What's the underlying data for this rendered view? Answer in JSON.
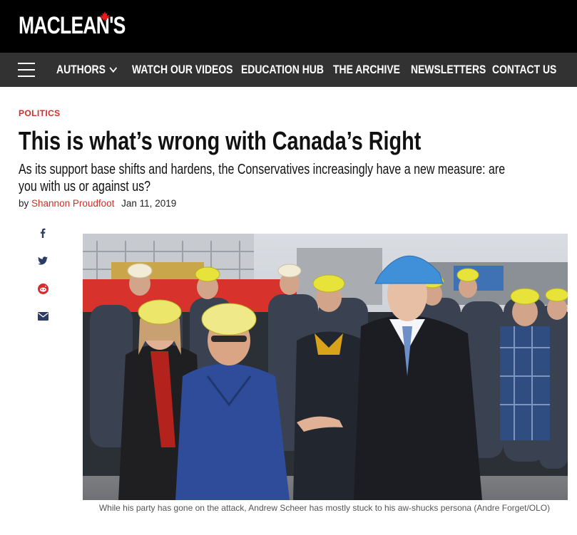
{
  "brand": {
    "logo_text": "MACLEAN'S"
  },
  "nav": {
    "items": [
      {
        "label": "AUTHORS",
        "has_dropdown": true
      },
      {
        "label": "WATCH OUR VIDEOS"
      },
      {
        "label": "EDUCATION HUB"
      },
      {
        "label": "THE ARCHIVE"
      },
      {
        "label": "NEWSLETTERS"
      },
      {
        "label": "CONTACT US"
      }
    ]
  },
  "article": {
    "section": "POLITICS",
    "headline": "This is what’s wrong with Canada’s Right",
    "dek": "As its support base shifts and hardens, the Conservatives increasingly have a new measure: are you with us or against us?",
    "by_prefix": "by",
    "author": "Shannon Proudfoot",
    "date": "Jan 11, 2019",
    "caption": "While his party has gone on the attack, Andrew Scheer has mostly stuck to his aw-shucks persona (Andre Forget/OLO)"
  },
  "share_icons": [
    "facebook-icon",
    "twitter-icon",
    "reddit-icon",
    "email-icon"
  ],
  "colors": {
    "accent": "#d62b2b",
    "topbar": "#000000",
    "navbar": "#323232",
    "share_icon": "#2b3c66"
  }
}
